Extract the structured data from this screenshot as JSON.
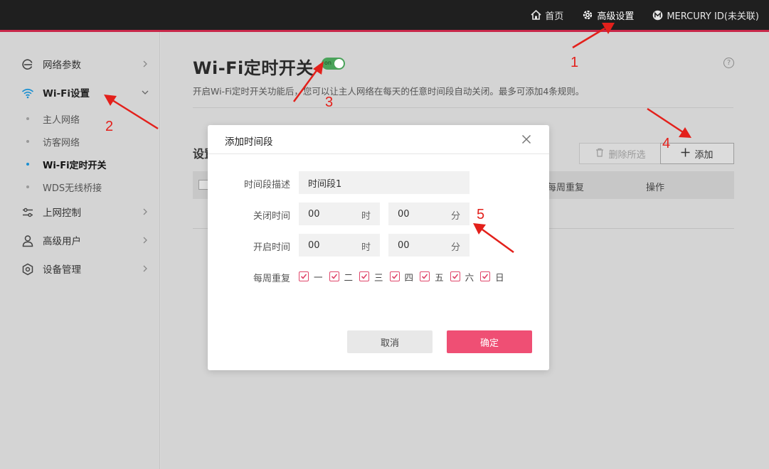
{
  "topnav": {
    "home": "首页",
    "advanced": "高级设置",
    "account": "MERCURY ID(未关联)"
  },
  "sidebar": {
    "items": [
      {
        "label": "网络参数"
      },
      {
        "label": "Wi-Fi设置"
      },
      {
        "label": "上网控制"
      },
      {
        "label": "高级用户"
      },
      {
        "label": "设备管理"
      }
    ],
    "subitems": [
      {
        "label": "主人网络"
      },
      {
        "label": "访客网络"
      },
      {
        "label": "Wi-Fi定时开关"
      },
      {
        "label": "WDS无线桥接"
      }
    ]
  },
  "main": {
    "title": "Wi-Fi定时开关",
    "toggle_text": "on",
    "description": "开启Wi-Fi定时开关功能后，您可以让主人网络在每天的任意时间段自动关闭。最多可添加4条规则。",
    "section_title": "设置",
    "delete_label": "删除所选",
    "add_label": "添加",
    "columns": [
      "每周重复",
      "操作"
    ]
  },
  "modal": {
    "title": "添加时间段",
    "desc_label": "时间段描述",
    "desc_value": "时间段1",
    "close_label": "关闭时间",
    "open_label": "开启时间",
    "repeat_label": "每周重复",
    "hour_unit": "时",
    "minute_unit": "分",
    "close_hour": "00",
    "close_minute": "00",
    "open_hour": "00",
    "open_minute": "00",
    "days": [
      "一",
      "二",
      "三",
      "四",
      "五",
      "六",
      "日"
    ],
    "cancel_label": "取消",
    "ok_label": "确定"
  },
  "annotations": [
    "1",
    "2",
    "3",
    "4",
    "5"
  ],
  "colors": {
    "accent": "#ef4f74",
    "topbar": "#1f1f1f",
    "topbar_line": "#c8284a",
    "toggle_on": "#4aa35a",
    "annotation": "#e3201b",
    "active_dot": "#1a8fd1"
  }
}
